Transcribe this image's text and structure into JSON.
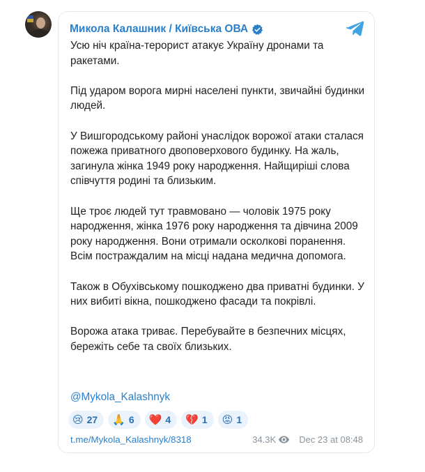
{
  "post": {
    "channel_name": "Микола Калашник / Київська ОВА",
    "paragraphs": [
      "Усю ніч країна-терорист атакує Україну дронами та ракетами.",
      "Під ударом ворога мирні населені пункти, звичайні будинки людей.",
      "У Вишгородському районі унаслідок ворожої атаки сталася пожежа приватного двоповерхового будинку. На жаль, загинула жінка 1949 року народження. Найщиріші слова співчуття родині та близьким.",
      "Ще троє людей тут травмовано — чоловік 1975 року народження, жінка 1976 року народження та дівчина 2009 року народження. Вони отримали осколкові поранення. Всім постраждалим на місці надана медична допомога.",
      "Також в Обухівському пошкоджено два приватні будинки. У них вибиті вікна, пошкоджено фасади та покрівлі.",
      "Ворожа атака триває. Перебувайте в безпечних місцях, бережіть себе та своїх близьких."
    ],
    "mention": "@Mykola_Kalashnyk",
    "reactions": [
      {
        "emoji": "😢",
        "icon": "crying-face-icon",
        "count": "27"
      },
      {
        "emoji": "🙏",
        "icon": "praying-hands-icon",
        "count": "6"
      },
      {
        "emoji": "❤️",
        "icon": "red-heart-icon",
        "count": "4"
      },
      {
        "emoji": "💔",
        "icon": "broken-heart-icon",
        "count": "1"
      },
      {
        "emoji": "😡",
        "icon": "angry-face-icon",
        "count": "1"
      }
    ],
    "link": "t.me/Mykola_Kalashnyk/8318",
    "views": "34.3K",
    "date": "Dec 23 at 08:48"
  },
  "colors": {
    "accent": "#2a7fc9",
    "reaction_bg": "#eaf3fc",
    "border": "#e4e8ec"
  }
}
